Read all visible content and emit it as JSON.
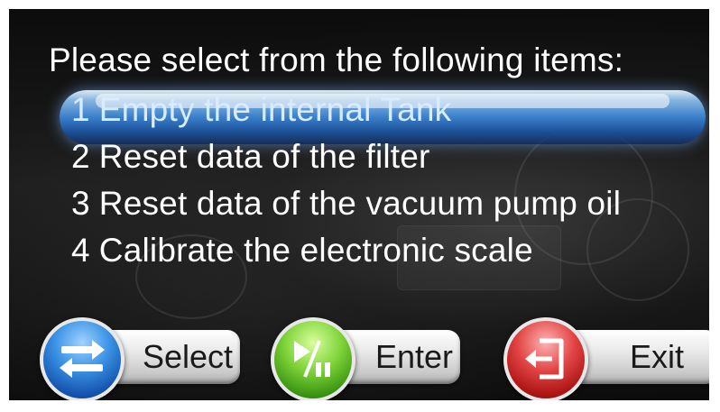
{
  "prompt": "Please select from the following items:",
  "menu": {
    "selected_index": 0,
    "items": [
      {
        "num": "1",
        "label": "Empty the internal Tank"
      },
      {
        "num": "2",
        "label": "Reset data of the filter"
      },
      {
        "num": "3",
        "label": "Reset data of the vacuum pump oil"
      },
      {
        "num": "4",
        "label": "Calibrate the electronic scale"
      }
    ]
  },
  "buttons": {
    "select": {
      "label": "Select",
      "icon": "swap-arrows-icon",
      "color": "#2f7fd6"
    },
    "enter": {
      "label": "Enter",
      "icon": "play-pause-icon",
      "color": "#5db822"
    },
    "exit": {
      "label": "Exit",
      "icon": "exit-door-icon",
      "color": "#c92020"
    }
  }
}
